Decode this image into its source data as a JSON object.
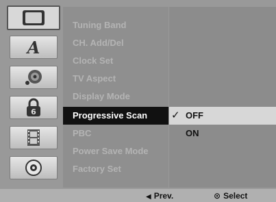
{
  "icon_tabs": [
    {
      "icon": "tv-screen-icon",
      "selected": true
    },
    {
      "icon": "language-a-icon",
      "selected": false
    },
    {
      "icon": "audio-disc-icon",
      "selected": false
    },
    {
      "icon": "lock-icon",
      "selected": false
    },
    {
      "icon": "film-icon",
      "selected": false
    },
    {
      "icon": "disc-icon",
      "selected": false
    }
  ],
  "menu": {
    "items": [
      {
        "label": "Tuning Band",
        "active": false
      },
      {
        "label": "CH. Add/Del",
        "active": false
      },
      {
        "label": "Clock Set",
        "active": false
      },
      {
        "label": "TV Aspect",
        "active": false
      },
      {
        "label": "Display Mode",
        "active": false
      },
      {
        "label": "Progressive Scan",
        "active": true
      },
      {
        "label": "PBC",
        "active": false
      },
      {
        "label": "Power Save Mode",
        "active": false
      },
      {
        "label": "Factory Set",
        "active": false
      }
    ]
  },
  "options": {
    "check_glyph": "✓",
    "items": [
      {
        "label": "OFF",
        "selected": true
      },
      {
        "label": "ON",
        "selected": false
      }
    ]
  },
  "hints": {
    "prev_glyph": "◀",
    "prev": "Prev.",
    "select_glyph": "⊙",
    "select": "Select"
  },
  "colors": {
    "active_menu_bg": "#111111",
    "selected_option_bg": "#d7d7d7"
  }
}
